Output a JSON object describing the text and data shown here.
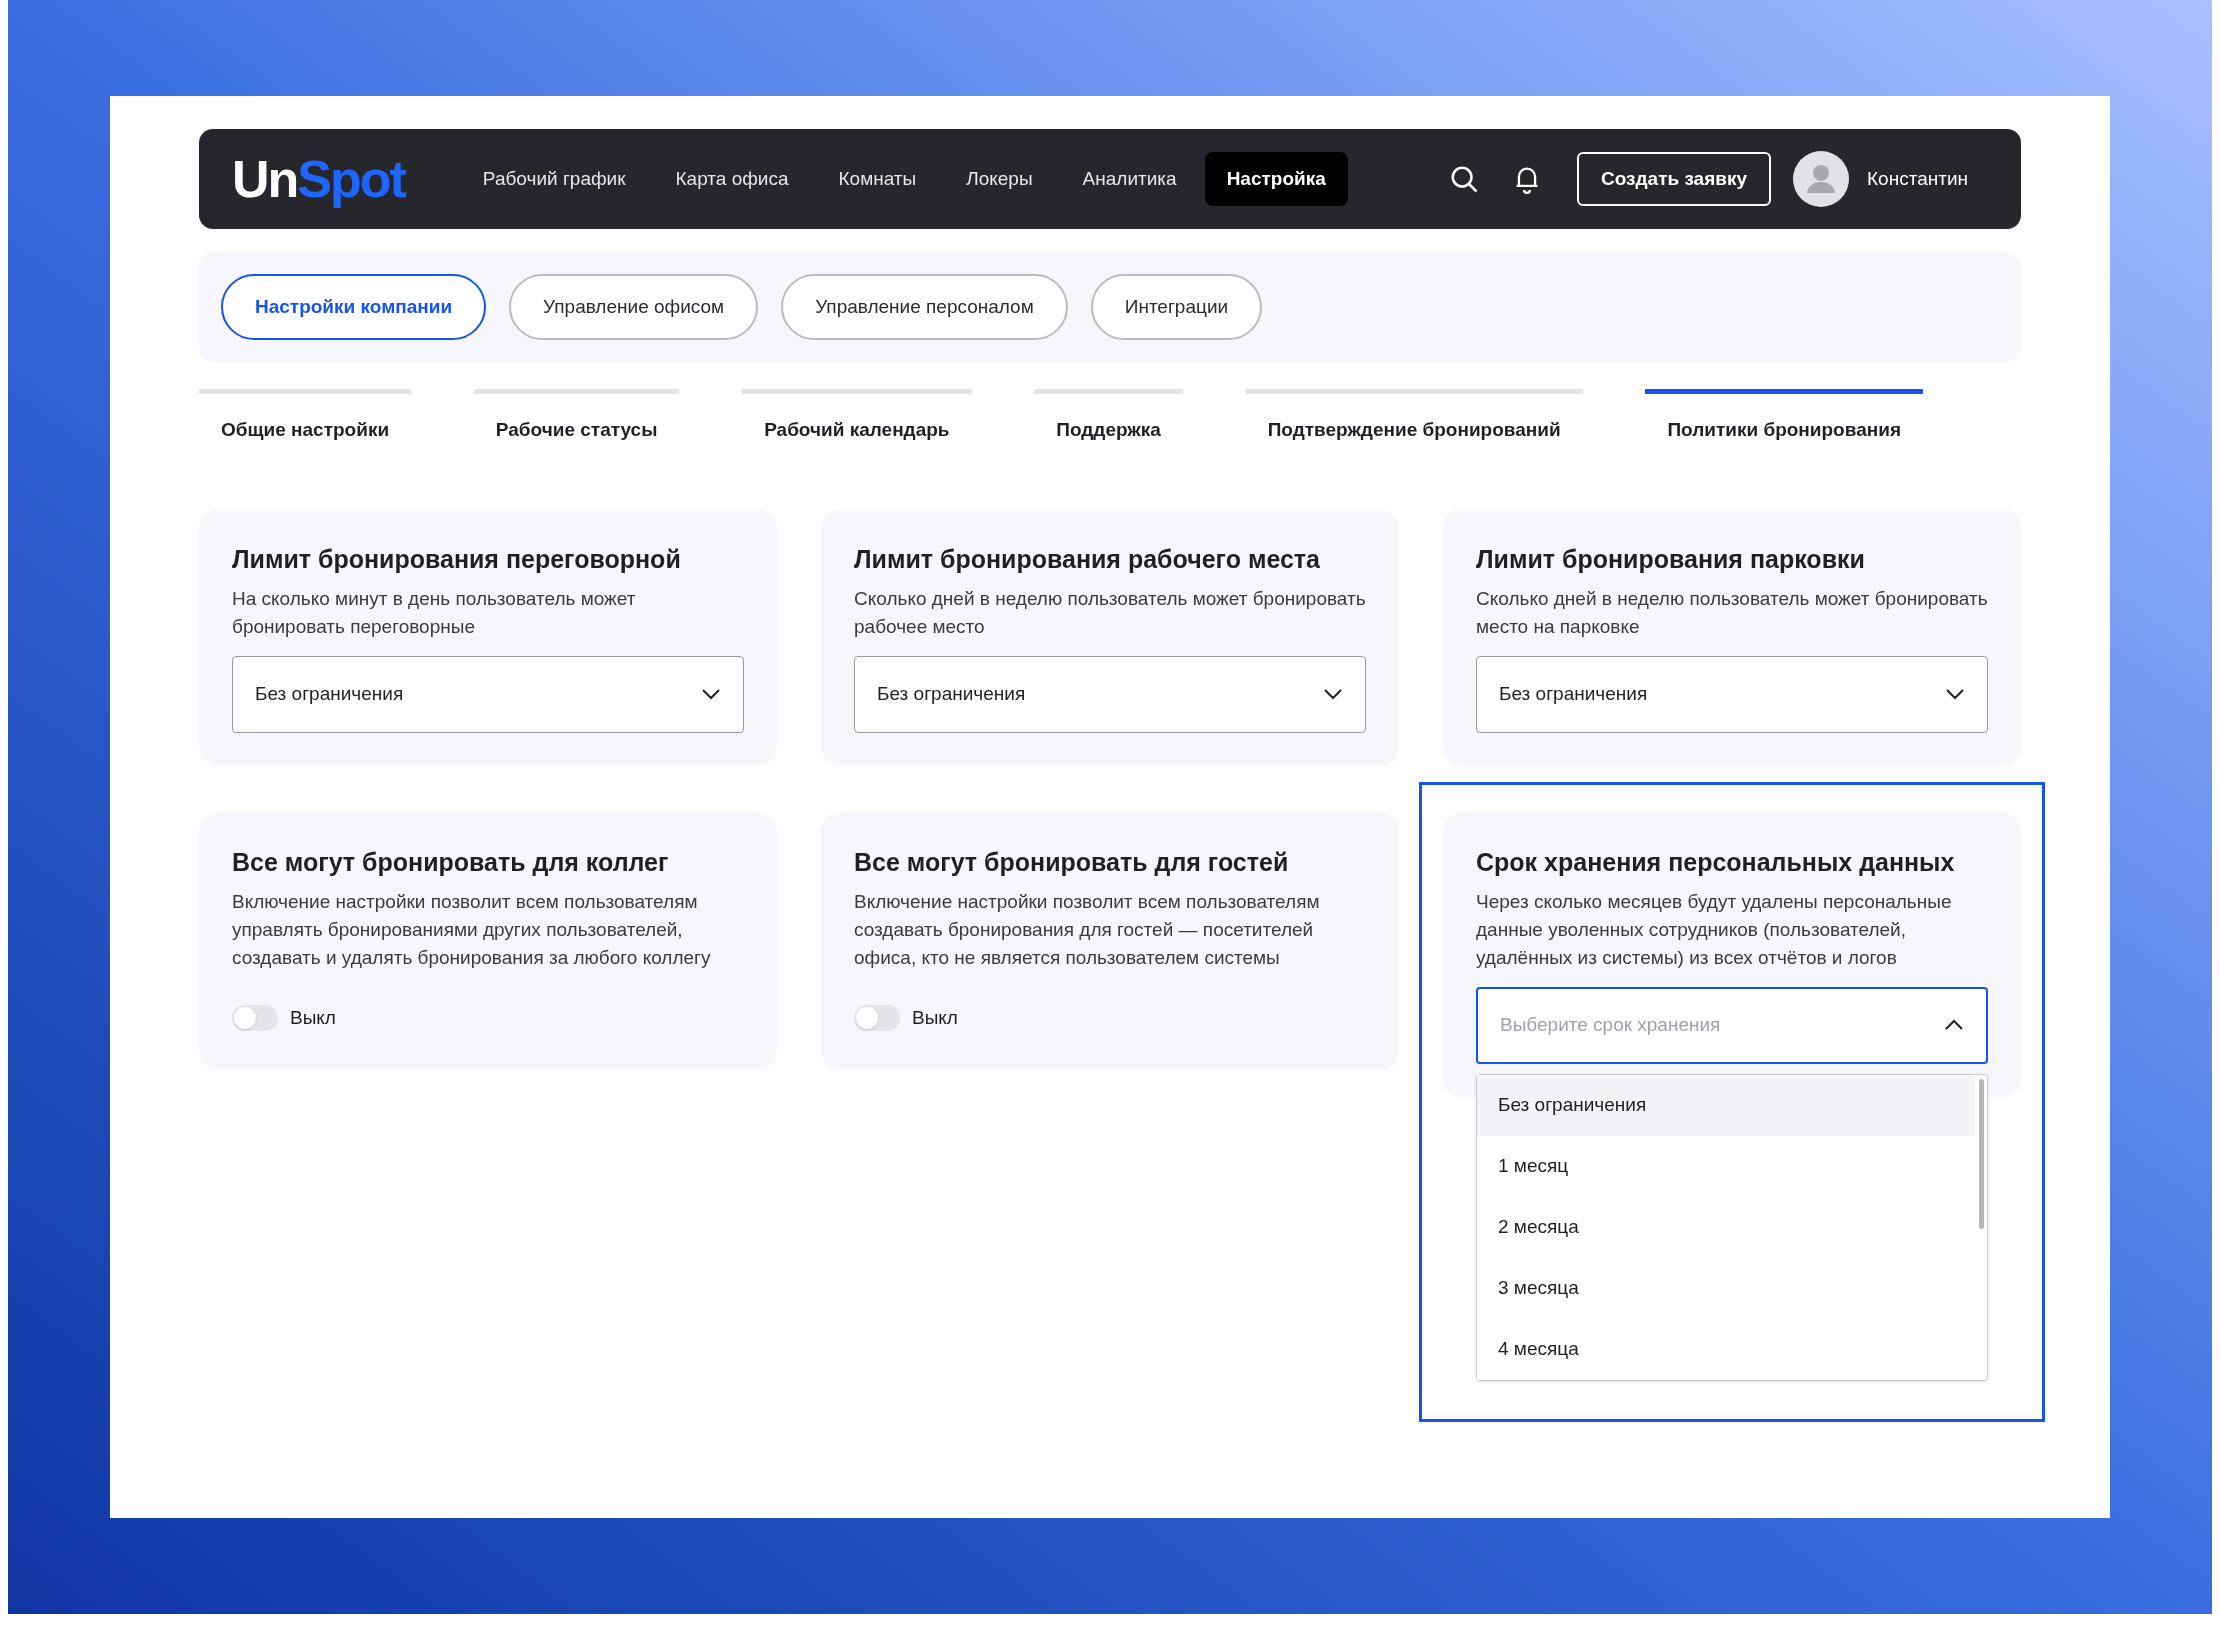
{
  "logo": [
    "Un",
    "Spot"
  ],
  "nav": [
    {
      "label": "Рабочий график",
      "selected": false
    },
    {
      "label": "Карта офиса",
      "selected": false
    },
    {
      "label": "Комнаты",
      "selected": false
    },
    {
      "label": "Локеры",
      "selected": false
    },
    {
      "label": "Аналитика",
      "selected": false
    },
    {
      "label": "Настройка",
      "selected": true
    }
  ],
  "create_button": "Создать заявку",
  "user": {
    "name": "Константин"
  },
  "sections": [
    {
      "label": "Настройки компании",
      "selected": true
    },
    {
      "label": "Управление офисом",
      "selected": false
    },
    {
      "label": "Управление персоналом",
      "selected": false
    },
    {
      "label": "Интеграции",
      "selected": false
    }
  ],
  "tabs": [
    {
      "label": "Общие настройки",
      "selected": false
    },
    {
      "label": "Рабочие статусы",
      "selected": false
    },
    {
      "label": "Рабочий календарь",
      "selected": false
    },
    {
      "label": "Поддержка",
      "selected": false
    },
    {
      "label": "Подтверждение бронирований",
      "selected": false
    },
    {
      "label": "Политики бронирования",
      "selected": true
    }
  ],
  "cards": [
    {
      "kind": "select",
      "title": "Лимит бронирования переговорной",
      "description": "На сколько минут в день пользователь может бронировать переговорные",
      "value": "Без ограничения",
      "expanded": false
    },
    {
      "kind": "select",
      "title": "Лимит бронирования рабочего места",
      "description": "Сколько дней в неделю пользователь может бронировать рабочее место",
      "value": "Без ограничения",
      "expanded": false
    },
    {
      "kind": "select",
      "title": "Лимит бронирования парковки",
      "description": "Сколько дней в неделю пользователь может бронировать место на парковке",
      "value": "Без ограничения",
      "expanded": false
    },
    {
      "kind": "toggle",
      "title": "Все могут бронировать для коллег",
      "description": "Включение настройки позволит всем пользователям управлять бронированиями других пользователей, создавать и удалять бронирования за любого коллегу",
      "on": false,
      "state_label": "Выкл"
    },
    {
      "kind": "toggle",
      "title": "Все могут бронировать для гостей",
      "description": "Включение настройки позволит всем пользователям создавать бронирования для гостей — посетителей офиса, кто не является пользователем системы",
      "on": false,
      "state_label": "Выкл"
    },
    {
      "kind": "select",
      "title": "Срок хранения персональных данных",
      "description": "Через сколько месяцев будут удалены персональные данные уволенных сотрудников (пользователей, удалённых из системы) из всех отчётов и логов",
      "placeholder": "Выберите срок хранения",
      "expanded": true,
      "highlighted": true,
      "options": [
        {
          "label": "Без ограничения",
          "selected": true
        },
        {
          "label": "1 месяц",
          "selected": false
        },
        {
          "label": "2 месяца",
          "selected": false
        },
        {
          "label": "3 месяца",
          "selected": false
        },
        {
          "label": "4 месяца",
          "selected": false
        }
      ]
    }
  ]
}
